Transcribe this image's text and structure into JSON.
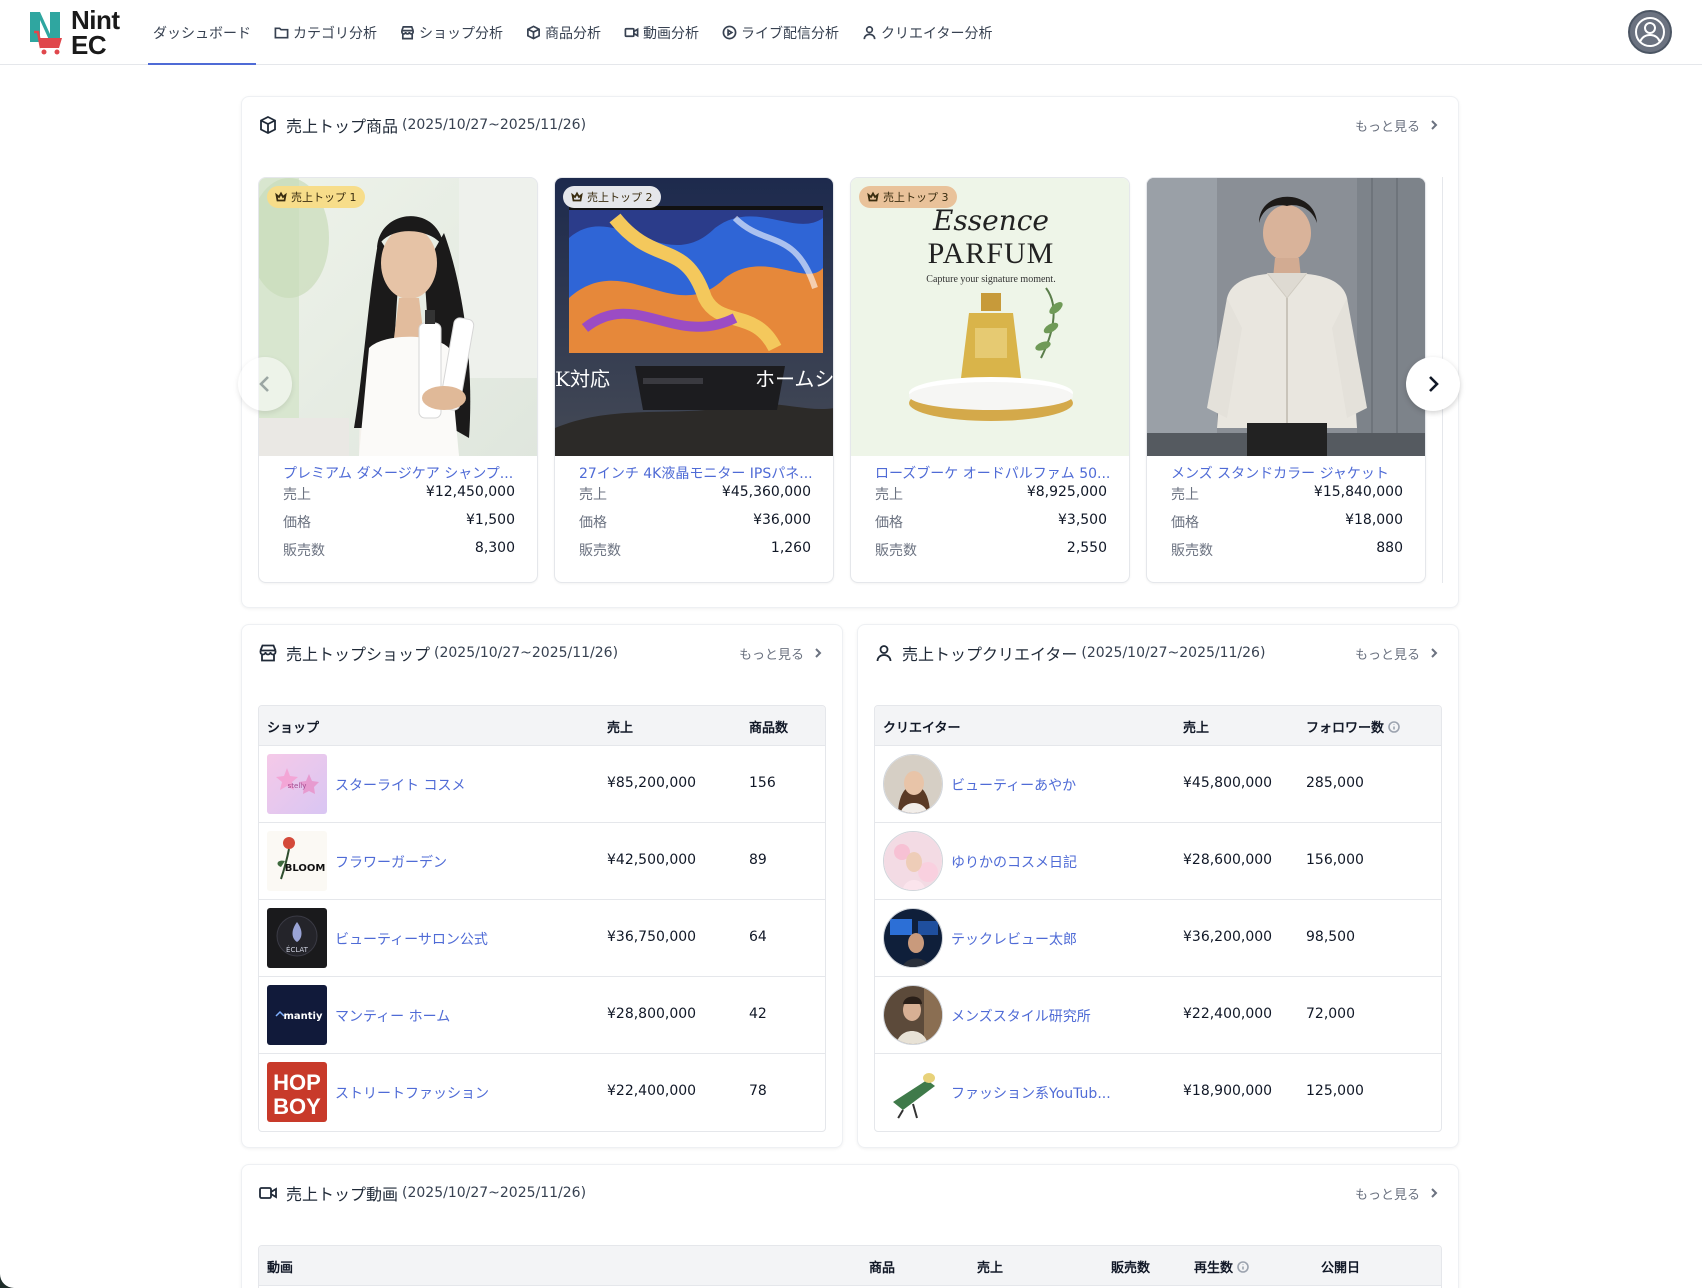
{
  "app": {
    "logo_line1": "Nint",
    "logo_line2": "EC"
  },
  "nav": [
    {
      "label": "ダッシュボード",
      "icon": "none",
      "active": true
    },
    {
      "label": "カテゴリ分析",
      "icon": "folder-icon"
    },
    {
      "label": "ショップ分析",
      "icon": "store-icon"
    },
    {
      "label": "商品分析",
      "icon": "box-icon"
    },
    {
      "label": "動画分析",
      "icon": "video-icon"
    },
    {
      "label": "ライブ配信分析",
      "icon": "play-circle-icon"
    },
    {
      "label": "クリエイター分析",
      "icon": "user-icon"
    }
  ],
  "products": {
    "title": "売上トップ商品",
    "range": "(2025/10/27~2025/11/26)",
    "more": "もっと見る",
    "label_sales": "売上",
    "label_price": "価格",
    "label_qty": "販売数",
    "items": [
      {
        "badge": "売上トップ 1",
        "name": "プレミアム ダメージケア シャンプ...",
        "sales": "¥12,450,000",
        "price": "¥1,500",
        "qty": "8,300"
      },
      {
        "badge": "売上トップ 2",
        "name": "27インチ 4K液晶モニター IPSパネ...",
        "sales": "¥45,360,000",
        "price": "¥36,000",
        "qty": "1,260",
        "img_text_left": "K対応",
        "img_text_right": "ホームシ"
      },
      {
        "badge": "売上トップ 3",
        "name": "ローズブーケ オードパルファム 50...",
        "sales": "¥8,925,000",
        "price": "¥3,500",
        "qty": "2,550",
        "img_script": "Essence",
        "img_title": "PARFUM",
        "img_sub": "Capture your signature moment."
      },
      {
        "name": "メンズ スタンドカラー ジャケット",
        "sales": "¥15,840,000",
        "price": "¥18,000",
        "qty": "880"
      }
    ]
  },
  "shops": {
    "title": "売上トップショップ",
    "range": "(2025/10/27~2025/11/26)",
    "more": "もっと見る",
    "headers": {
      "shop": "ショップ",
      "sales": "売上",
      "count": "商品数"
    },
    "rows": [
      {
        "name": "スターライト コスメ",
        "sales": "¥85,200,000",
        "count": "156",
        "logo": "stelly"
      },
      {
        "name": "フラワーガーデン",
        "sales": "¥42,500,000",
        "count": "89",
        "logo": "BLOOM"
      },
      {
        "name": "ビューティーサロン公式",
        "sales": "¥36,750,000",
        "count": "64",
        "logo": "ÉCLAT"
      },
      {
        "name": "マンティー ホーム",
        "sales": "¥28,800,000",
        "count": "42",
        "logo": "mantiy"
      },
      {
        "name": "ストリートファッション",
        "sales": "¥22,400,000",
        "count": "78",
        "logo_line1": "HOP",
        "logo_line2": "BOY"
      }
    ]
  },
  "creators": {
    "title": "売上トップクリエイター",
    "range": "(2025/10/27~2025/11/26)",
    "more": "もっと見る",
    "headers": {
      "creator": "クリエイター",
      "sales": "売上",
      "followers": "フォロワー数"
    },
    "rows": [
      {
        "name": "ビューティーあやか",
        "sales": "¥45,800,000",
        "followers": "285,000"
      },
      {
        "name": "ゆりかのコスメ日記",
        "sales": "¥28,600,000",
        "followers": "156,000"
      },
      {
        "name": "テックレビュー太郎",
        "sales": "¥36,200,000",
        "followers": "98,500"
      },
      {
        "name": "メンズスタイル研究所",
        "sales": "¥22,400,000",
        "followers": "72,000"
      },
      {
        "name": "ファッション系YouTub...",
        "sales": "¥18,900,000",
        "followers": "125,000"
      }
    ]
  },
  "videos": {
    "title": "売上トップ動画",
    "range": "(2025/10/27~2025/11/26)",
    "more": "もっと見る",
    "headers": {
      "video": "動画",
      "product": "商品",
      "sales": "売上",
      "qty": "販売数",
      "plays": "再生数",
      "date": "公開日"
    }
  },
  "colors": {
    "accent": "#4f6bd6",
    "gold_badge": "#f7dd8a",
    "silver_badge": "#e5e7eb",
    "bronze_badge": "#e9c29a"
  }
}
